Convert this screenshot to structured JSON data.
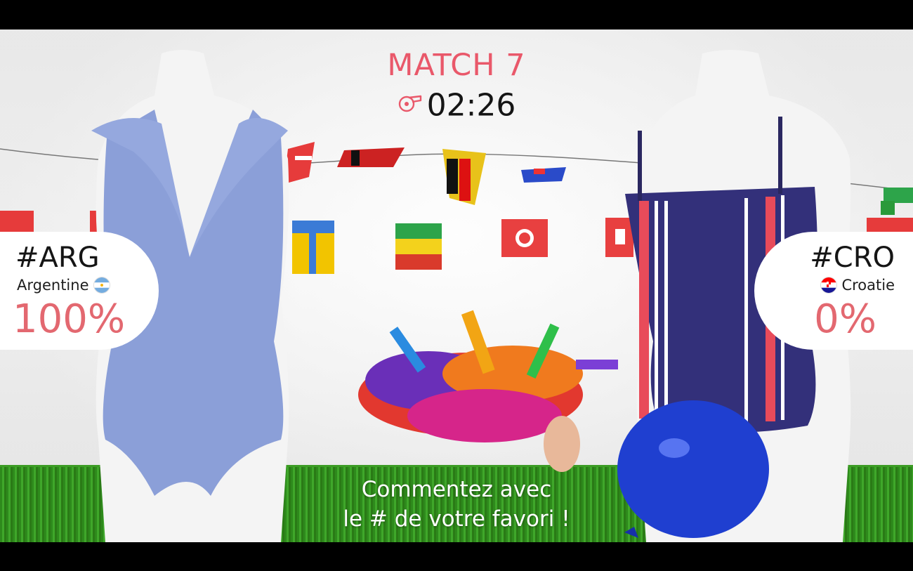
{
  "match": {
    "title": "MATCH 7",
    "timer": "02:26"
  },
  "left": {
    "tag": "#ARG",
    "country": "Argentine",
    "percent": "100%",
    "flag": "argentina-flag-icon"
  },
  "right": {
    "tag": "#CRO",
    "country": "Croatie",
    "percent": "0%",
    "flag": "croatia-flag-icon"
  },
  "cta": {
    "line1": "Commentez avec",
    "line2": "le # de votre favori !"
  },
  "colors": {
    "accent": "#e9586a",
    "percent": "#e36870",
    "swimsuit_left": "#8b9fd8",
    "swimsuit_right": "#33307a",
    "balloon": "#1f3fd0"
  }
}
